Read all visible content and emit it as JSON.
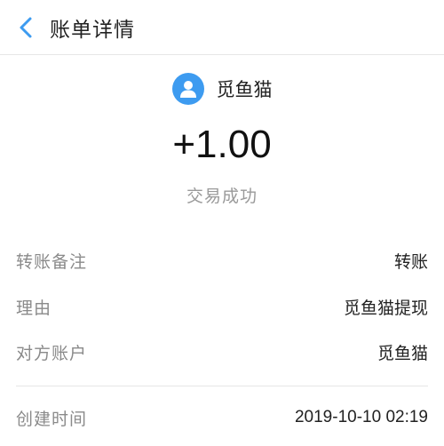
{
  "header": {
    "title": "账单详情",
    "back_icon": "chevron-left-icon"
  },
  "colors": {
    "accent": "#3d9bf0",
    "avatar_bg": "#3d9bf0",
    "muted_text": "#9a9a9a"
  },
  "payee": {
    "name": "觅鱼猫",
    "avatar_icon": "user-icon"
  },
  "transaction": {
    "amount": "+1.00",
    "status": "交易成功"
  },
  "details": [
    {
      "label": "转账备注",
      "value": "转账"
    },
    {
      "label": "理由",
      "value": "觅鱼猫提现"
    },
    {
      "label": "对方账户",
      "value": "觅鱼猫"
    }
  ],
  "meta": [
    {
      "label": "创建时间",
      "value": "2019-10-10 02:19"
    }
  ]
}
